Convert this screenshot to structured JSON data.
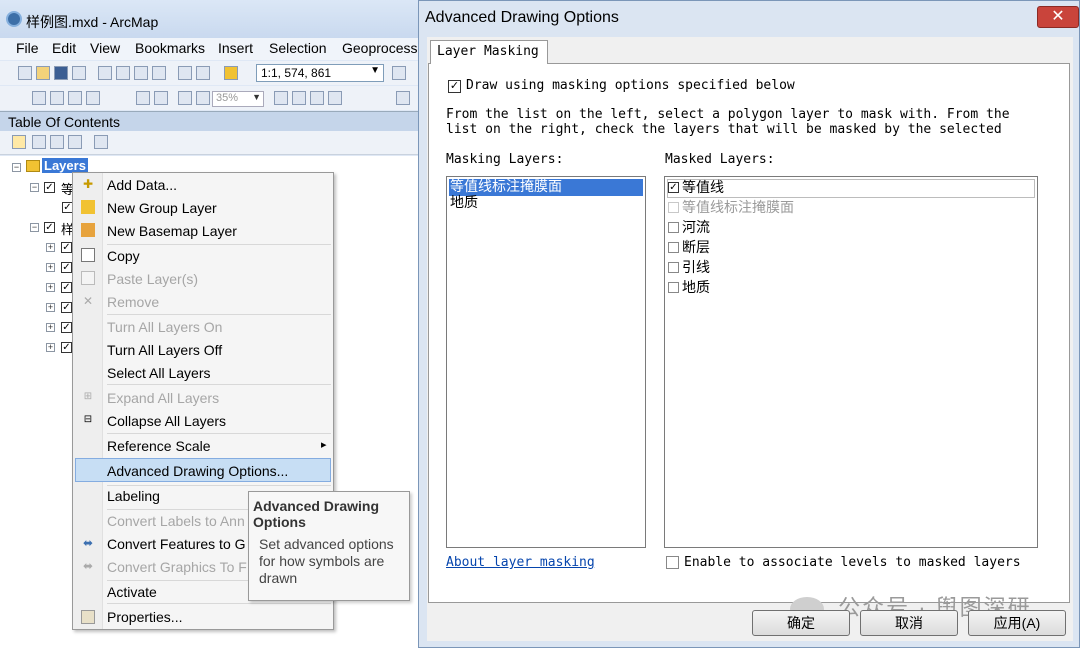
{
  "arcmap": {
    "title": "样例图.mxd - ArcMap",
    "menu": [
      "File",
      "Edit",
      "View",
      "Bookmarks",
      "Insert",
      "Selection",
      "Geoprocess"
    ],
    "scale_value": "1:1, 574, 861",
    "zoom_value": "35%",
    "toc_title": "Table Of Contents",
    "layers_label": "Layers",
    "tree": [
      "等",
      "样"
    ]
  },
  "context_menu": {
    "items": [
      {
        "label": "Add Data...",
        "enabled": true
      },
      {
        "label": "New Group Layer",
        "enabled": true
      },
      {
        "label": "New Basemap Layer",
        "enabled": true
      },
      {
        "label": "Copy",
        "enabled": true
      },
      {
        "label": "Paste Layer(s)",
        "enabled": false
      },
      {
        "label": "Remove",
        "enabled": false
      },
      {
        "label": "Turn All Layers On",
        "enabled": false
      },
      {
        "label": "Turn All Layers Off",
        "enabled": true
      },
      {
        "label": "Select All Layers",
        "enabled": true
      },
      {
        "label": "Expand All Layers",
        "enabled": false
      },
      {
        "label": "Collapse All Layers",
        "enabled": true
      },
      {
        "label": "Reference Scale",
        "enabled": true
      },
      {
        "label": "Advanced Drawing Options...",
        "enabled": true
      },
      {
        "label": "Labeling",
        "enabled": true
      },
      {
        "label": "Convert Labels to Ann",
        "enabled": false
      },
      {
        "label": "Convert Features to G",
        "enabled": true
      },
      {
        "label": "Convert Graphics To F",
        "enabled": false
      },
      {
        "label": "Activate",
        "enabled": true
      },
      {
        "label": "Properties...",
        "enabled": true
      }
    ],
    "submenu_arrow": "▸",
    "tooltip_title": "Advanced Drawing Options",
    "tooltip_body": "Set advanced options for how symbols are drawn"
  },
  "dialog": {
    "title": "Advanced Drawing Options",
    "close": "✕",
    "tab": "Layer Masking",
    "draw_checkbox_label": "Draw using masking options specified below",
    "instructions_line1": "From the list on the left, select a polygon layer to mask with. From the",
    "instructions_line2": "list on the right, check the layers that will be masked by the selected",
    "masking_layers_label": "Masking Layers:",
    "masked_layers_label": "Masked Layers:",
    "masking_layers": [
      "等值线标注掩膜面",
      "地质"
    ],
    "masked_layers": [
      {
        "label": "等值线",
        "checked": true,
        "enabled": true
      },
      {
        "label": "等值线标注掩膜面",
        "checked": false,
        "enabled": false
      },
      {
        "label": "河流",
        "checked": false,
        "enabled": true
      },
      {
        "label": "断层",
        "checked": false,
        "enabled": true
      },
      {
        "label": "引线",
        "checked": false,
        "enabled": true
      },
      {
        "label": "地质",
        "checked": false,
        "enabled": true
      }
    ],
    "about_link": "About layer masking",
    "enable_levels_label": "Enable to associate levels to masked layers",
    "ok": "确定",
    "cancel": "取消",
    "apply": "应用(A)"
  },
  "watermark": "公众号 · 舆图深研",
  "colors": {
    "selection": "#3a78d6",
    "highlight": "#c7def4",
    "close": "#c9443b"
  }
}
